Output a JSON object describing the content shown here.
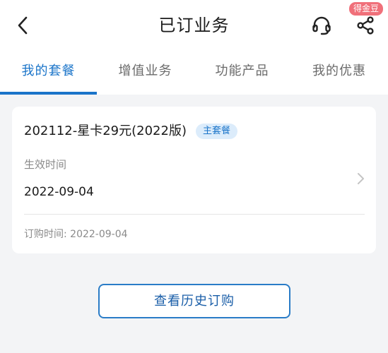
{
  "header": {
    "title": "已订业务",
    "back_icon": "chevron-left-icon",
    "support_icon": "headset-icon",
    "share_icon": "share-icon",
    "badge": "得金豆",
    "badge_color": "#f0707a"
  },
  "tabs": [
    {
      "label": "我的套餐",
      "active": true
    },
    {
      "label": "增值业务",
      "active": false
    },
    {
      "label": "功能产品",
      "active": false
    },
    {
      "label": "我的优惠",
      "active": false
    }
  ],
  "plan": {
    "name": "202112-星卡29元(2022版)",
    "badge": "主套餐",
    "effective_label": "生效时间",
    "effective_date": "2022-09-04",
    "order_time": "订购时间: 2022-09-04"
  },
  "actions": {
    "history_button": "查看历史订购"
  },
  "colors": {
    "accent": "#1a74c9",
    "background": "#f3f4f6"
  }
}
